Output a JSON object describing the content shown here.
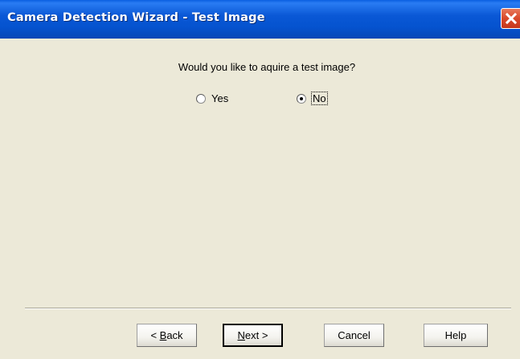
{
  "window": {
    "title": "Camera Detection Wizard - Test Image",
    "close_icon": "close-icon"
  },
  "question": {
    "text": "Would you like to aquire a test image?"
  },
  "options": [
    {
      "label": "Yes",
      "selected": false
    },
    {
      "label": "No",
      "selected": true
    }
  ],
  "buttons": {
    "back": {
      "arrow": "<",
      "accel": "B",
      "rest": "ack"
    },
    "next": {
      "accel": "N",
      "rest": "ext",
      "arrow": ">"
    },
    "cancel": "Cancel",
    "help": "Help"
  },
  "colors": {
    "titlebar": "#0a58d6",
    "dialog_bg": "#ece9d8",
    "close_button": "#d9492a"
  }
}
